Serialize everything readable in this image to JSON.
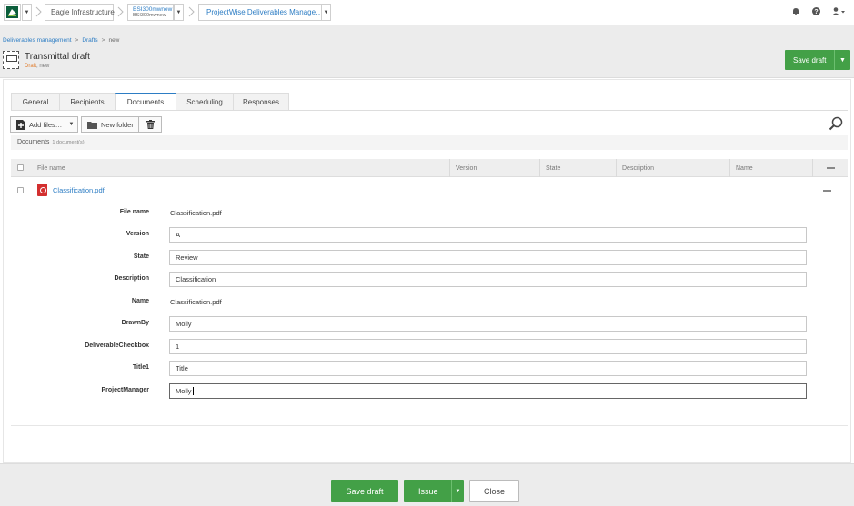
{
  "topbar": {
    "project": "Eagle Infrastructure",
    "datasource": {
      "line1": "BSI300mwnew",
      "line2": "BSI300mwnew"
    },
    "app": "ProjectWise Deliverables Manage…",
    "icons": [
      "bell-icon",
      "help-icon",
      "user-icon"
    ]
  },
  "header": {
    "breadcrumb": [
      "Deliverables management",
      "Drafts",
      "new"
    ],
    "title": "Transmittal draft",
    "status": "Draft",
    "status_suffix": ", new",
    "save_draft": "Save draft"
  },
  "tabs": [
    "General",
    "Recipients",
    "Documents",
    "Scheduling",
    "Responses"
  ],
  "active_tab": "Documents",
  "toolbar": {
    "add_files": "Add files…",
    "new_folder": "New folder"
  },
  "documents": {
    "label": "Documents",
    "count": "1 document(s)"
  },
  "columns": [
    "File name",
    "Version",
    "State",
    "Description",
    "Name"
  ],
  "file": {
    "name": "Classification.pdf",
    "fields": [
      {
        "label": "File name",
        "value": "Classification.pdf",
        "type": "text"
      },
      {
        "label": "Version",
        "value": "A",
        "type": "input"
      },
      {
        "label": "State",
        "value": "Review",
        "type": "input"
      },
      {
        "label": "Description",
        "value": "Classification",
        "type": "input"
      },
      {
        "label": "Name",
        "value": "Classification.pdf",
        "type": "text"
      },
      {
        "label": "DrawnBy",
        "value": "Molly",
        "type": "input"
      },
      {
        "label": "DeliverableCheckbox",
        "value": "1",
        "type": "input"
      },
      {
        "label": "Title1",
        "value": "Title",
        "type": "input"
      },
      {
        "label": "ProjectManager",
        "value": "Molly",
        "type": "input"
      }
    ]
  },
  "footer": {
    "save_draft": "Save draft",
    "issue": "Issue",
    "close": "Close"
  },
  "colors": {
    "accent": "#2d7dc4",
    "primary": "#43a047",
    "status": "#e07b2a"
  }
}
